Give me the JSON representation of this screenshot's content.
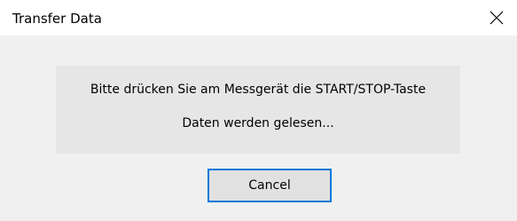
{
  "window": {
    "title": "Transfer Data",
    "close_icon": "close-icon"
  },
  "message": {
    "line1": "Bitte drücken Sie am Messgerät die START/STOP-Taste",
    "line2": "Daten werden gelesen..."
  },
  "buttons": {
    "cancel_label": "Cancel"
  },
  "colors": {
    "focus_border": "#0078d7",
    "dialog_bg": "#f0f0f0",
    "panel_bg": "#e6e6e6",
    "button_bg": "#e1e1e1"
  }
}
